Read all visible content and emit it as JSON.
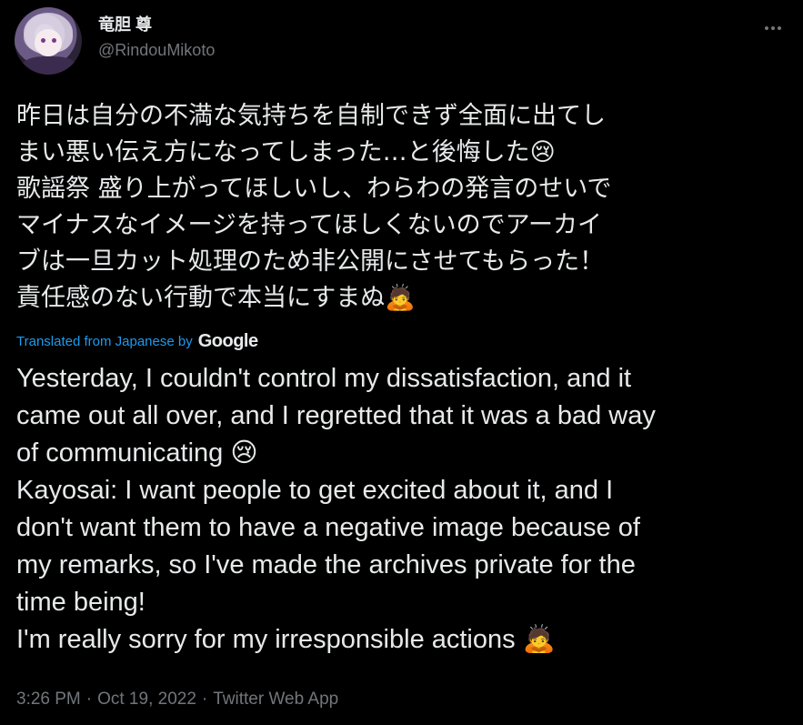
{
  "author": {
    "display_name": "竜胆 尊",
    "handle": "@RindouMikoto"
  },
  "tweet": {
    "original_text": "昨日は自分の不満な気持ちを自制できず全面に出てし\nまい悪い伝え方になってしまった…と後悔した😢\n歌謡祭 盛り上がってほしいし、わらわの発言のせいで\nマイナスなイメージを持ってほしくないのでアーカイ\nブは一旦カット処理のため非公開にさせてもらった！\n責任感のない行動で本当にすまぬ🙇",
    "translation_label": "Translated from Japanese by",
    "translation_provider": "Google",
    "translated_text": "Yesterday, I couldn't control my dissatisfaction, and it\ncame out all over, and I regretted that it was a bad way\nof communicating 😢\nKayosai: I want people to get excited about it, and I\ndon't want them to have a negative image because of\nmy remarks, so I've made the archives private for the\ntime being!\nI'm really sorry for my irresponsible actions 🙇",
    "time": "3:26 PM",
    "date": "Oct 19, 2022",
    "source": "Twitter Web App",
    "separator": "·"
  },
  "icons": {
    "more": "more-horizontal-icon",
    "avatar": "profile-avatar"
  },
  "colors": {
    "background": "#000000",
    "text": "#e7e9ea",
    "secondary": "#71767b",
    "link": "#1d9bf0"
  }
}
